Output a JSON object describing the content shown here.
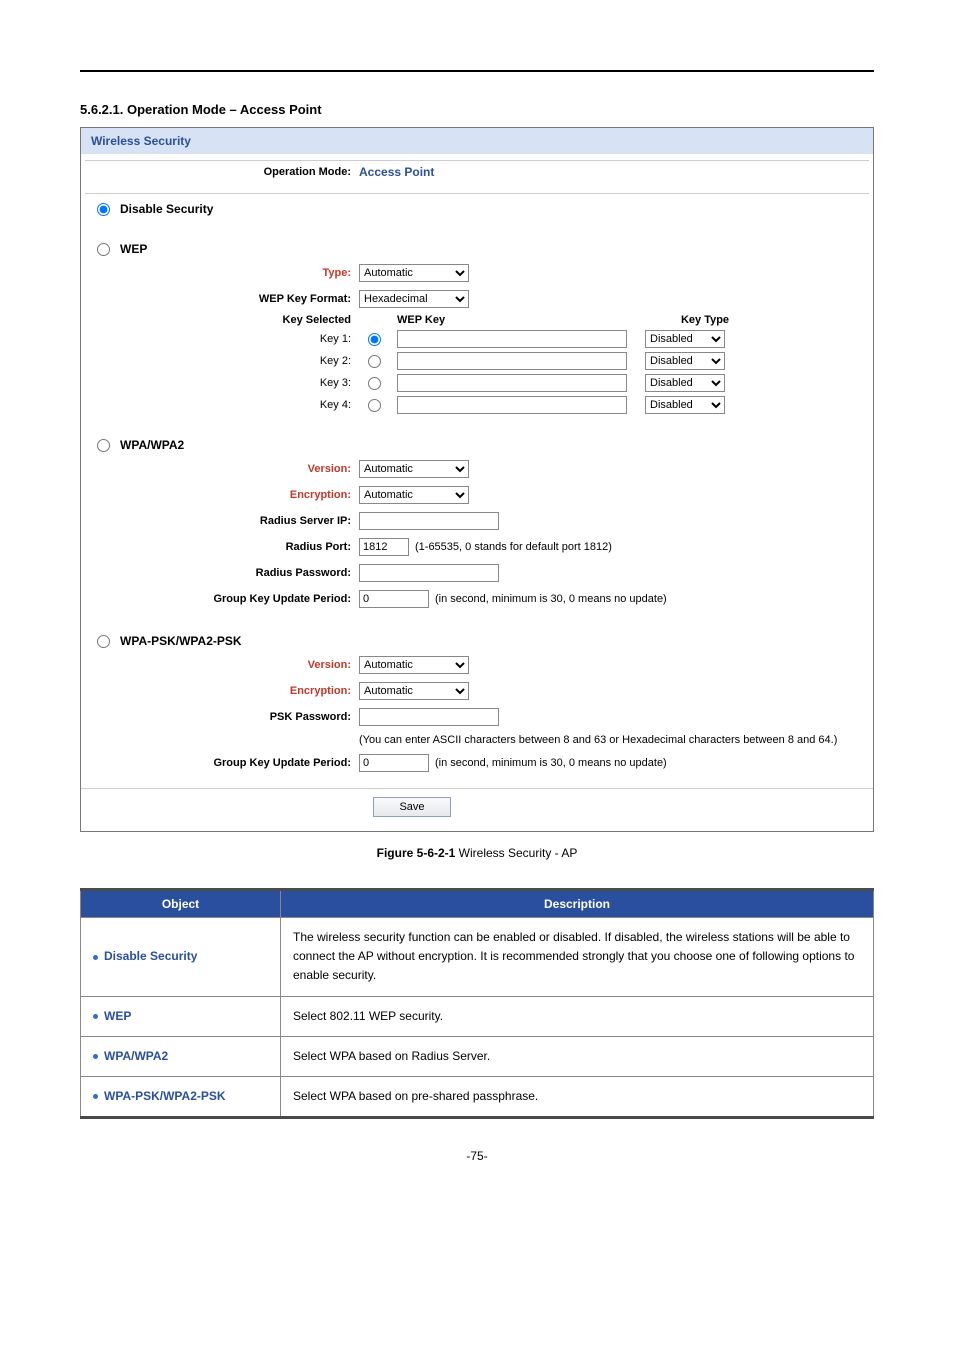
{
  "heading": {
    "num": "5.6.2.1.",
    "title": "Operation Mode – Access Point"
  },
  "panel": {
    "title": "Wireless Security",
    "opmode_label": "Operation Mode:",
    "opmode_value": "Access Point",
    "disable_label": "Disable Security",
    "wep": {
      "label": "WEP",
      "type_label": "Type:",
      "type_value": "Automatic",
      "fmt_label": "WEP Key Format:",
      "fmt_value": "Hexadecimal",
      "keysel_header": "Key Selected",
      "wepkey_header": "WEP Key",
      "keytype_header": "Key Type",
      "keys": [
        {
          "label": "Key 1:",
          "type": "Disabled"
        },
        {
          "label": "Key 2:",
          "type": "Disabled"
        },
        {
          "label": "Key 3:",
          "type": "Disabled"
        },
        {
          "label": "Key 4:",
          "type": "Disabled"
        }
      ]
    },
    "wpa": {
      "label": "WPA/WPA2",
      "version_label": "Version:",
      "version_value": "Automatic",
      "enc_label": "Encryption:",
      "enc_value": "Automatic",
      "radius_ip_label": "Radius Server IP:",
      "radius_port_label": "Radius Port:",
      "radius_port_value": "1812",
      "radius_port_hint": "(1-65535, 0 stands for default port 1812)",
      "radius_pw_label": "Radius Password:",
      "gkup_label": "Group Key Update Period:",
      "gkup_value": "0",
      "gkup_hint": "(in second, minimum is 30, 0 means no update)"
    },
    "psk": {
      "label": "WPA-PSK/WPA2-PSK",
      "version_label": "Version:",
      "version_value": "Automatic",
      "enc_label": "Encryption:",
      "enc_value": "Automatic",
      "pw_label": "PSK Password:",
      "pw_hint": "(You can enter ASCII characters between 8 and 63 or Hexadecimal characters between 8 and 64.)",
      "gkup_label": "Group Key Update Period:",
      "gkup_value": "0",
      "gkup_hint": "(in second, minimum is 30, 0 means no update)"
    },
    "save": "Save"
  },
  "caption": {
    "bold": "Figure 5-6-2-1",
    "rest": " Wireless Security - AP"
  },
  "table": {
    "head_obj": "Object",
    "head_desc": "Description",
    "rows": [
      {
        "obj": "Disable Security",
        "desc": "The wireless security function can be enabled or disabled. If disabled, the wireless stations will be able to connect the AP without encryption. It is recommended strongly that you choose one of following options to enable security."
      },
      {
        "obj": "WEP",
        "desc": "Select 802.11 WEP security."
      },
      {
        "obj": "WPA/WPA2",
        "desc": "Select WPA based on Radius Server."
      },
      {
        "obj": "WPA-PSK/WPA2-PSK",
        "desc": "Select WPA based on pre-shared passphrase."
      }
    ]
  },
  "pagenum": "-75-"
}
